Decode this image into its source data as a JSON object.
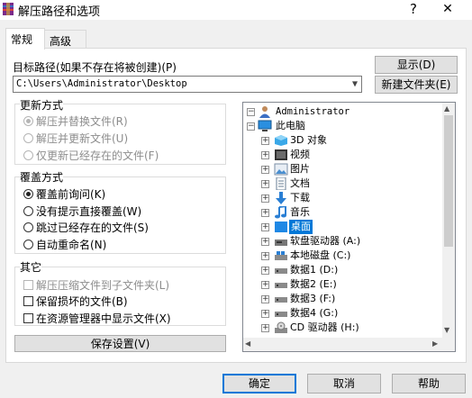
{
  "window": {
    "title": "解压路径和选项",
    "help_glyph": "?",
    "close_glyph": "✕"
  },
  "tabs": [
    {
      "label": "常规",
      "active": true
    },
    {
      "label": "高级",
      "active": false
    }
  ],
  "destination": {
    "label": "目标路径(如果不存在将被创建)(P)",
    "value": "C:\\Users\\Administrator\\Desktop"
  },
  "buttons": {
    "show": "显示(D)",
    "new_folder": "新建文件夹(E)",
    "save_settings": "保存设置(V)",
    "ok": "确定",
    "cancel": "取消",
    "help": "帮助"
  },
  "update_mode": {
    "title": "更新方式",
    "options": [
      {
        "label": "解压并替换文件(R)",
        "selected": true
      },
      {
        "label": "解压并更新文件(U)",
        "selected": false
      },
      {
        "label": "仅更新已经存在的文件(F)",
        "selected": false
      }
    ]
  },
  "overwrite_mode": {
    "title": "覆盖方式",
    "options": [
      {
        "label": "覆盖前询问(K)",
        "selected": true
      },
      {
        "label": "没有提示直接覆盖(W)",
        "selected": false
      },
      {
        "label": "跳过已经存在的文件(S)",
        "selected": false
      },
      {
        "label": "自动重命名(N)",
        "selected": false
      }
    ]
  },
  "misc": {
    "title": "其它",
    "options": [
      {
        "label": "解压压缩文件到子文件夹(L)",
        "checked": false,
        "disabled": true
      },
      {
        "label": "保留损坏的文件(B)",
        "checked": false,
        "disabled": false
      },
      {
        "label": "在资源管理器中显示文件(X)",
        "checked": false,
        "disabled": false
      }
    ]
  },
  "tree": {
    "root": "Administrator",
    "pc": "此电脑",
    "items": [
      {
        "label": "3D 对象",
        "icon": "3d-objects-icon"
      },
      {
        "label": "视频",
        "icon": "video-folder-icon"
      },
      {
        "label": "图片",
        "icon": "pictures-folder-icon"
      },
      {
        "label": "文档",
        "icon": "documents-folder-icon"
      },
      {
        "label": "下载",
        "icon": "downloads-folder-icon"
      },
      {
        "label": "音乐",
        "icon": "music-folder-icon"
      },
      {
        "label": "桌面",
        "icon": "desktop-folder-icon",
        "selected": true
      },
      {
        "label": "软盘驱动器 (A:)",
        "icon": "floppy-drive-icon"
      },
      {
        "label": "本地磁盘 (C:)",
        "icon": "local-disk-icon"
      },
      {
        "label": "数据1 (D:)",
        "icon": "drive-icon"
      },
      {
        "label": "数据2 (E:)",
        "icon": "drive-icon"
      },
      {
        "label": "数据3 (F:)",
        "icon": "drive-icon"
      },
      {
        "label": "数据4 (G:)",
        "icon": "drive-icon"
      },
      {
        "label": "CD 驱动器 (H:)",
        "icon": "cd-drive-icon"
      }
    ]
  },
  "colors": {
    "accent": "#0078d7",
    "selection": "#0078d7"
  }
}
